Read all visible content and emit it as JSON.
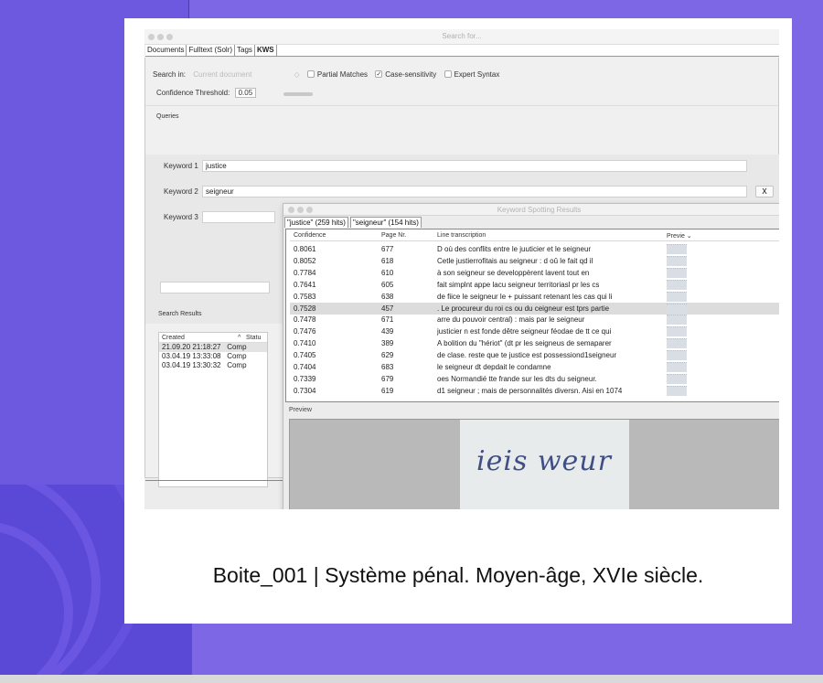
{
  "window": {
    "title": "Search for..."
  },
  "tabs": [
    "Documents",
    "Fulltext (Solr)",
    "Tags",
    "KWS"
  ],
  "search": {
    "search_in_label": "Search in:",
    "search_in_value": "Current document",
    "stepper_glyph": "◇",
    "partial_matches": "Partial Matches",
    "case_sensitivity": "Case-sensitivity",
    "case_checked_glyph": "✓",
    "expert_syntax": "Expert Syntax",
    "threshold_label": "Confidence Threshold:",
    "threshold_value": "0.05"
  },
  "queries": {
    "section_label": "Queries",
    "keywords": [
      {
        "label": "Keyword 1",
        "value": "justice"
      },
      {
        "label": "Keyword 2",
        "value": "seigneur"
      },
      {
        "label": "Keyword 3",
        "value": ""
      }
    ],
    "remove_label": "X"
  },
  "search_results": {
    "section_label": "Search Results",
    "col_created": "Created",
    "col_status": "Statu",
    "sort_glyph": "^",
    "rows": [
      {
        "created": "21.09.20 21:18:27",
        "status": "Comp"
      },
      {
        "created": "03.04.19 13:33:08",
        "status": "Comp"
      },
      {
        "created": "03.04.19 13:30:32",
        "status": "Comp"
      }
    ]
  },
  "kws_window": {
    "title": "Keyword Spotting Results",
    "tabs": [
      "\"justice\" (259 hits)",
      "\"seigneur\" (154 hits)"
    ],
    "headers": {
      "confidence": "Confidence",
      "page": "Page Nr.",
      "line": "Line transcription",
      "preview": "Previe ⌄"
    },
    "rows": [
      {
        "confidence": "0.8061",
        "page": "677",
        "line": "D où des conflits entre le juuticier et le seigneur"
      },
      {
        "confidence": "0.8052",
        "page": "618",
        "line": "Cetle justierrofitais au seigneur : d oû le fait qd il"
      },
      {
        "confidence": "0.7784",
        "page": "610",
        "line": "à son seigneur se developpèrent lavent tout en"
      },
      {
        "confidence": "0.7641",
        "page": "605",
        "line": "fait simplnt appe lacu seigneur territoriasl pr les cs"
      },
      {
        "confidence": "0.7583",
        "page": "638",
        "line": "de fiice le seigneur le + puissant retenant les cas qui li"
      },
      {
        "confidence": "0.7528",
        "page": "457",
        "line": ". Le procureur du roi cs ou du ceigneur est tprs partie"
      },
      {
        "confidence": "0.7478",
        "page": "671",
        "line": "arre du pouvoir central) : mais par le seigneur"
      },
      {
        "confidence": "0.7476",
        "page": "439",
        "line": "justicier n est fonde dêtre seigneur féodae de tt ce qui"
      },
      {
        "confidence": "0.7410",
        "page": "389",
        "line": "A bolition du \"hériot\" (dt pr les seigneus de semaparer"
      },
      {
        "confidence": "0.7405",
        "page": "629",
        "line": "de clase.  reste que te justice est possessiond1seigneur"
      },
      {
        "confidence": "0.7404",
        "page": "683",
        "line": "le seigneur dt depdait le condamne"
      },
      {
        "confidence": "0.7339",
        "page": "679",
        "line": "oes Normandié tte frande sur les dts du seigneur."
      },
      {
        "confidence": "0.7304",
        "page": "619",
        "line": "d1 seigneur ; mais de personnalités diversn. Aisi en 1074"
      }
    ],
    "preview_label": "Preview",
    "preview_handwriting": "ieis weur"
  },
  "caption": "Boite_001 | Système pénal. Moyen-âge, XVIe siècle.",
  "colors": {
    "background": "#7e67e4",
    "card": "#ffffff",
    "selected_row": "#dcdcdc"
  }
}
